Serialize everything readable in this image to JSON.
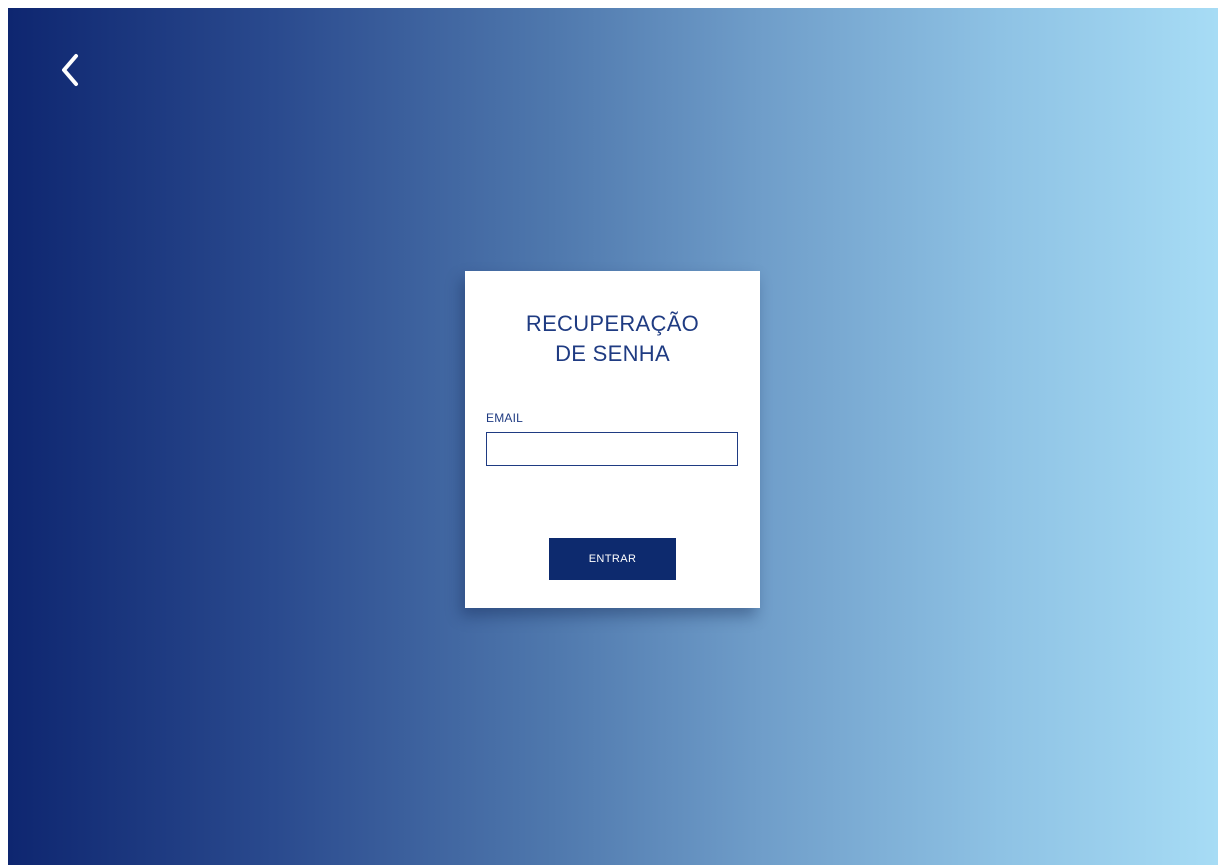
{
  "navigation": {
    "back_icon": "chevron-left-icon"
  },
  "card": {
    "title_line1": "RECUPERAÇÃO",
    "title_line2": "DE SENHA",
    "email_label": "EMAIL",
    "email_value": "",
    "email_placeholder": "",
    "submit_label": "ENTRAR"
  },
  "colors": {
    "gradient_start": "#0e2670",
    "gradient_end": "#a7dcf5",
    "accent": "#1f3b82",
    "button": "#0d2a6e"
  }
}
